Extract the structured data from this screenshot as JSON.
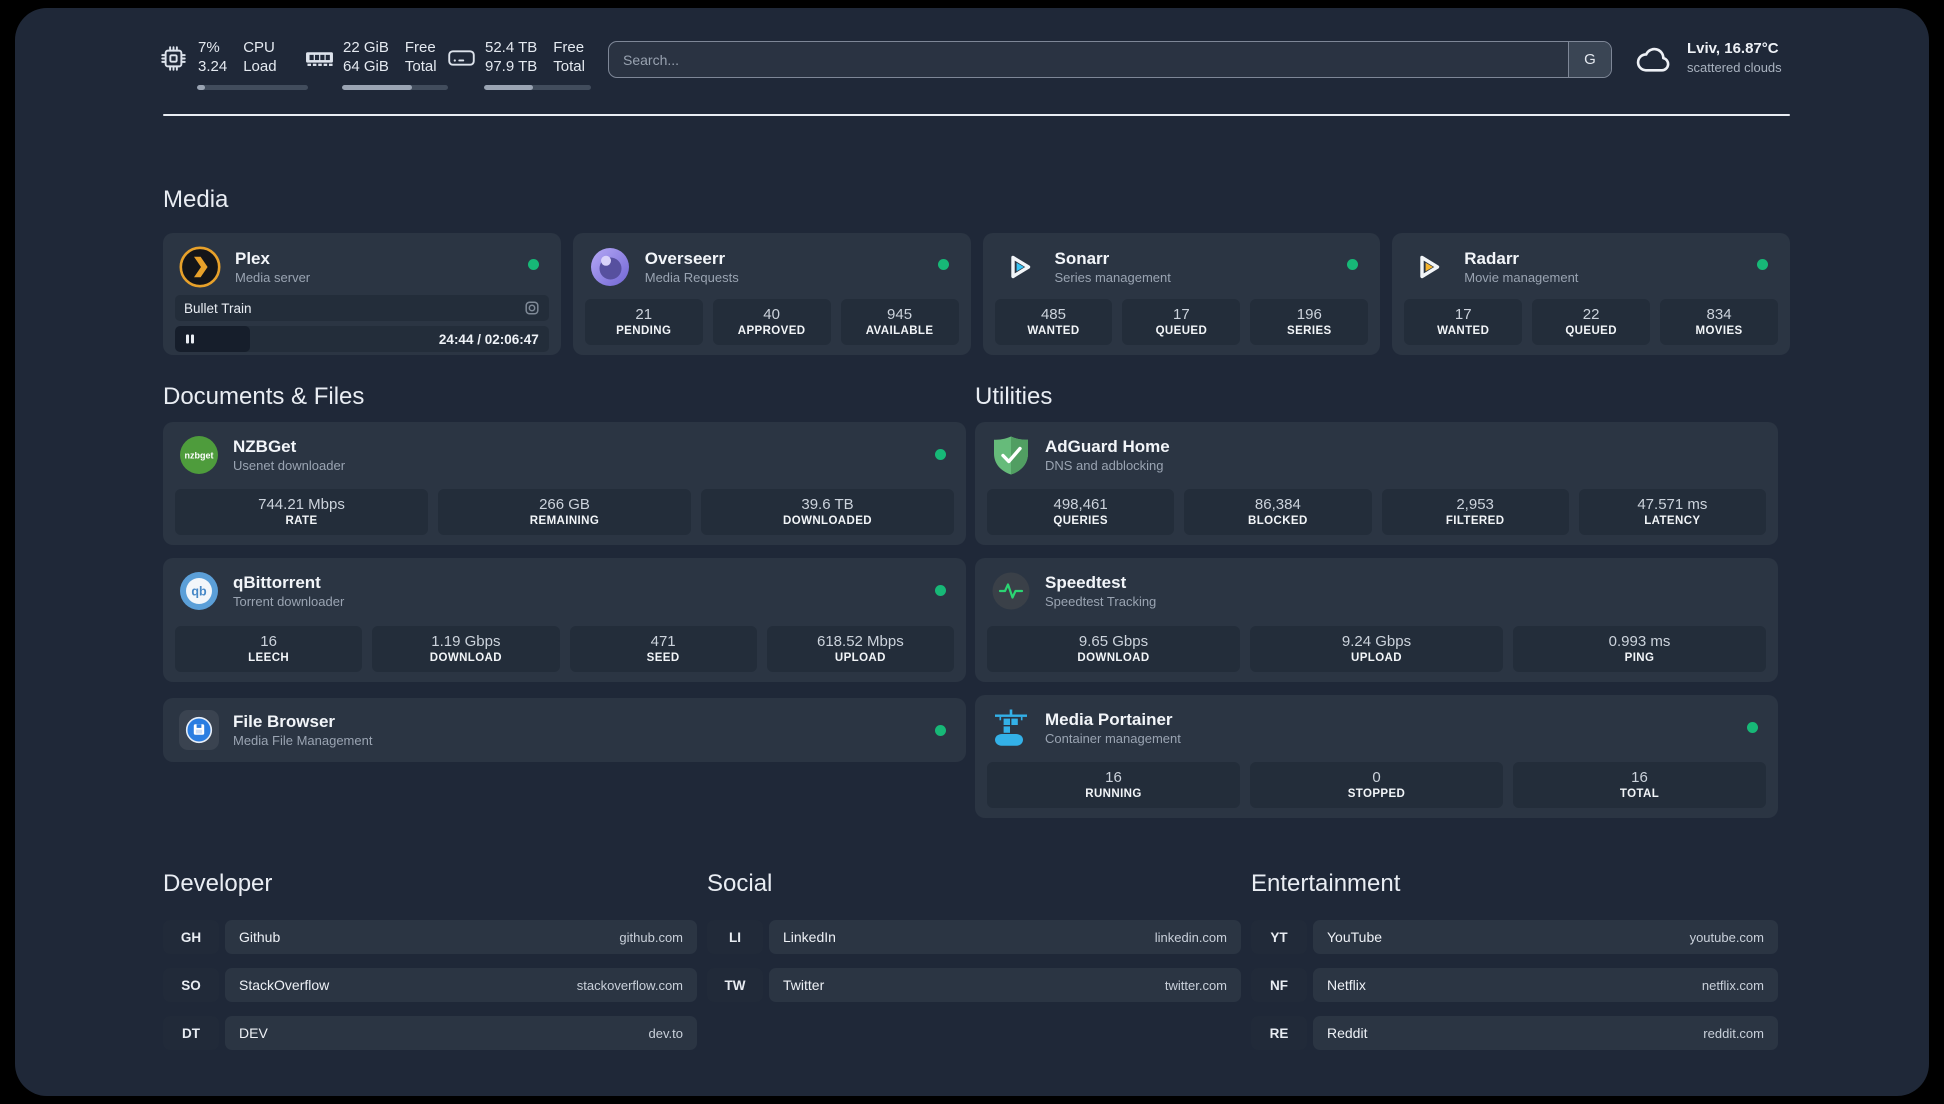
{
  "topbar": {
    "cpu": {
      "value_top": "7%",
      "value_bottom": "3.24",
      "label_top": "CPU",
      "label_bottom": "Load",
      "progress_pct": 7
    },
    "memory": {
      "value_top": "22 GiB",
      "value_bottom": "64 GiB",
      "label_top": "Free",
      "label_bottom": "Total",
      "progress_pct": 66
    },
    "disk": {
      "value_top": "52.4 TB",
      "value_bottom": "97.9 TB",
      "label_top": "Free",
      "label_bottom": "Total",
      "progress_pct": 46
    },
    "search": {
      "placeholder": "Search...",
      "button_label": "G"
    },
    "weather": {
      "location": "Lviv, 16.87°C",
      "condition": "scattered clouds"
    }
  },
  "sections": {
    "media": {
      "title": "Media"
    },
    "documents": {
      "title": "Documents & Files"
    },
    "utilities": {
      "title": "Utilities"
    },
    "developer": {
      "title": "Developer"
    },
    "social": {
      "title": "Social"
    },
    "entertainment": {
      "title": "Entertainment"
    }
  },
  "cards": {
    "plex": {
      "name": "Plex",
      "description": "Media server",
      "status": "online",
      "now_playing": "Bullet Train",
      "time_display": "24:44 / 02:06:47",
      "progress_pct": 20
    },
    "overseerr": {
      "name": "Overseerr",
      "description": "Media Requests",
      "status": "online",
      "stats": [
        {
          "value": "21",
          "label": "PENDING"
        },
        {
          "value": "40",
          "label": "APPROVED"
        },
        {
          "value": "945",
          "label": "AVAILABLE"
        }
      ]
    },
    "sonarr": {
      "name": "Sonarr",
      "description": "Series management",
      "status": "online",
      "stats": [
        {
          "value": "485",
          "label": "WANTED"
        },
        {
          "value": "17",
          "label": "QUEUED"
        },
        {
          "value": "196",
          "label": "SERIES"
        }
      ]
    },
    "radarr": {
      "name": "Radarr",
      "description": "Movie management",
      "status": "online",
      "stats": [
        {
          "value": "17",
          "label": "WANTED"
        },
        {
          "value": "22",
          "label": "QUEUED"
        },
        {
          "value": "834",
          "label": "MOVIES"
        }
      ]
    },
    "nzbget": {
      "name": "NZBGet",
      "description": "Usenet downloader",
      "status": "online",
      "icon_text": "nzbget",
      "stats": [
        {
          "value": "744.21 Mbps",
          "label": "RATE"
        },
        {
          "value": "266 GB",
          "label": "REMAINING"
        },
        {
          "value": "39.6 TB",
          "label": "DOWNLOADED"
        }
      ]
    },
    "qbittorrent": {
      "name": "qBittorrent",
      "description": "Torrent downloader",
      "status": "online",
      "icon_text": "qb",
      "stats": [
        {
          "value": "16",
          "label": "LEECH"
        },
        {
          "value": "1.19 Gbps",
          "label": "DOWNLOAD"
        },
        {
          "value": "471",
          "label": "SEED"
        },
        {
          "value": "618.52 Mbps",
          "label": "UPLOAD"
        }
      ]
    },
    "filebrowser": {
      "name": "File Browser",
      "description": "Media File Management",
      "status": "online"
    },
    "adguard": {
      "name": "AdGuard Home",
      "description": "DNS and adblocking",
      "stats": [
        {
          "value": "498,461",
          "label": "QUERIES"
        },
        {
          "value": "86,384",
          "label": "BLOCKED"
        },
        {
          "value": "2,953",
          "label": "FILTERED"
        },
        {
          "value": "47.571 ms",
          "label": "LATENCY"
        }
      ]
    },
    "speedtest": {
      "name": "Speedtest",
      "description": "Speedtest Tracking",
      "stats": [
        {
          "value": "9.65 Gbps",
          "label": "DOWNLOAD"
        },
        {
          "value": "9.24 Gbps",
          "label": "UPLOAD"
        },
        {
          "value": "0.993 ms",
          "label": "PING"
        }
      ]
    },
    "portainer": {
      "name": "Media Portainer",
      "description": "Container management",
      "status": "online",
      "stats": [
        {
          "value": "16",
          "label": "RUNNING"
        },
        {
          "value": "0",
          "label": "STOPPED"
        },
        {
          "value": "16",
          "label": "TOTAL"
        }
      ]
    }
  },
  "links": {
    "developer": [
      {
        "abbr": "GH",
        "name": "Github",
        "url": "github.com"
      },
      {
        "abbr": "SO",
        "name": "StackOverflow",
        "url": "stackoverflow.com"
      },
      {
        "abbr": "DT",
        "name": "DEV",
        "url": "dev.to"
      }
    ],
    "social": [
      {
        "abbr": "LI",
        "name": "LinkedIn",
        "url": "linkedin.com"
      },
      {
        "abbr": "TW",
        "name": "Twitter",
        "url": "twitter.com"
      }
    ],
    "entertainment": [
      {
        "abbr": "YT",
        "name": "YouTube",
        "url": "youtube.com"
      },
      {
        "abbr": "NF",
        "name": "Netflix",
        "url": "netflix.com"
      },
      {
        "abbr": "RE",
        "name": "Reddit",
        "url": "reddit.com"
      }
    ]
  },
  "colors": {
    "background": "#1f2838",
    "card": "#2b3543",
    "tile": "#232d3a",
    "status_online_green": "#17b877",
    "plex_amber": "#e8a12a",
    "overseerr_purple": "#7b6fd6",
    "sonarr_cyan": "#39c4f3",
    "radarr_yellow": "#f5b52f",
    "nzbget_green": "#4e9c3c",
    "qbittorrent_blue": "#5b9fd8",
    "adguard_green": "#66bb7a",
    "speedtest_green": "#2bd573",
    "portainer_blue": "#33b1e8",
    "filebrowser_blue": "#2a7de1"
  }
}
